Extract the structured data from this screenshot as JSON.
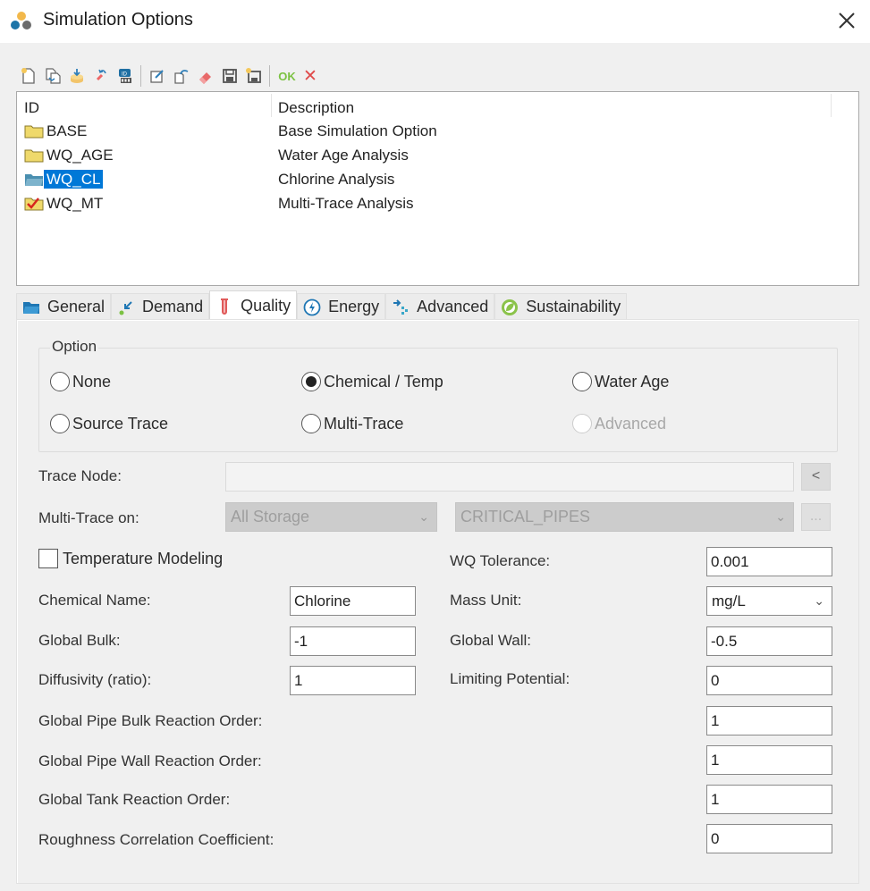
{
  "window": {
    "title": "Simulation Options",
    "close_icon": "close-x-icon"
  },
  "toolbar": {
    "items": [
      {
        "name": "new-icon"
      },
      {
        "name": "duplicate-icon"
      },
      {
        "name": "import-icon"
      },
      {
        "name": "rename-icon"
      },
      {
        "name": "id-icon"
      },
      {
        "name": "edit-icon"
      },
      {
        "name": "undo-icon"
      },
      {
        "name": "delete-icon"
      },
      {
        "name": "save-icon"
      },
      {
        "name": "save-as-icon"
      }
    ],
    "ok_label": "OK",
    "cancel_label": "✕"
  },
  "grid": {
    "headers": {
      "id": "ID",
      "description": "Description"
    },
    "rows": [
      {
        "id": "BASE",
        "description": "Base Simulation Option",
        "icon": "folder-icon",
        "selected": false
      },
      {
        "id": "WQ_AGE",
        "description": "Water Age Analysis",
        "icon": "folder-icon",
        "selected": false
      },
      {
        "id": "WQ_CL",
        "description": "Chlorine Analysis",
        "icon": "folder-open-icon",
        "selected": true
      },
      {
        "id": "WQ_MT",
        "description": "Multi-Trace Analysis",
        "icon": "folder-checked-icon",
        "selected": false
      }
    ]
  },
  "tabs": [
    {
      "label": "General",
      "icon": "folder-icon",
      "active": false
    },
    {
      "label": "Demand",
      "icon": "demand-arrow-icon",
      "active": false
    },
    {
      "label": "Quality",
      "icon": "test-tube-icon",
      "active": true
    },
    {
      "label": "Energy",
      "icon": "energy-bolt-icon",
      "active": false
    },
    {
      "label": "Advanced",
      "icon": "advanced-flow-icon",
      "active": false
    },
    {
      "label": "Sustainability",
      "icon": "leaf-icon",
      "active": false
    }
  ],
  "quality": {
    "option_group": {
      "legend": "Option",
      "selected": "Chemical / Temp",
      "options": [
        {
          "label": "None",
          "checked": false,
          "disabled": false
        },
        {
          "label": "Chemical / Temp",
          "checked": true,
          "disabled": false
        },
        {
          "label": "Water Age",
          "checked": false,
          "disabled": false
        },
        {
          "label": "Source Trace",
          "checked": false,
          "disabled": false
        },
        {
          "label": "Multi-Trace",
          "checked": false,
          "disabled": false
        },
        {
          "label": "Advanced",
          "checked": false,
          "disabled": true
        }
      ]
    },
    "trace_node": {
      "label": "Trace Node:",
      "value": "",
      "pick_button": "<"
    },
    "multi_trace": {
      "label": "Multi-Trace on:",
      "value": "All Storage",
      "set_value": "CRITICAL_PIPES",
      "browse_button": "..."
    },
    "temperature_modeling": {
      "label": "Temperature Modeling",
      "checked": false
    },
    "chemical_name": {
      "label": "Chemical Name:",
      "value": "Chlorine"
    },
    "global_bulk": {
      "label": "Global Bulk:",
      "value": "-1"
    },
    "diffusivity": {
      "label": "Diffusivity (ratio):",
      "value": "1"
    },
    "wq_tolerance": {
      "label": "WQ Tolerance:",
      "value": "0.001"
    },
    "mass_unit": {
      "label": "Mass Unit:",
      "value": "mg/L"
    },
    "global_wall": {
      "label": "Global Wall:",
      "value": "-0.5"
    },
    "limiting_potential": {
      "label": "Limiting Potential:",
      "value": "0"
    },
    "pipe_bulk_order": {
      "label": "Global Pipe Bulk Reaction Order:",
      "value": "1"
    },
    "pipe_wall_order": {
      "label": "Global Pipe Wall Reaction Order:",
      "value": "1"
    },
    "tank_order": {
      "label": "Global Tank Reaction Order:",
      "value": "1"
    },
    "roughness_coeff": {
      "label": "Roughness Correlation Coefficient:",
      "value": "0"
    }
  }
}
